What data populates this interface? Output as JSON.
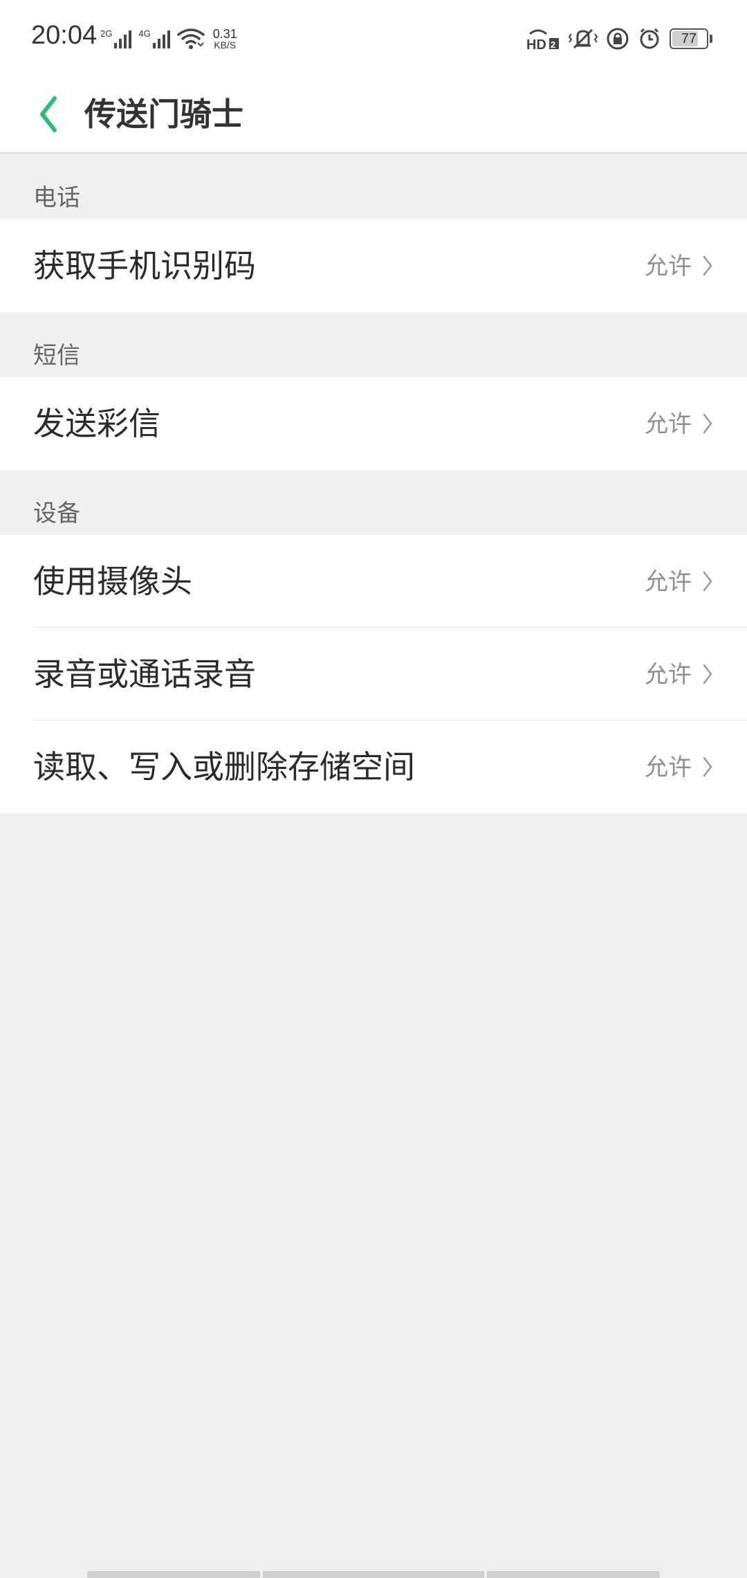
{
  "status_bar": {
    "time": "20:04",
    "sim1_label": "2G",
    "sim2_label": "4G",
    "speed_value": "0.31",
    "speed_unit": "KB/S",
    "battery": "77",
    "battery_level": 0.77
  },
  "header": {
    "title": "传送门骑士"
  },
  "sections": [
    {
      "title": "电话",
      "items": [
        {
          "label": "获取手机识别码",
          "value": "允许"
        }
      ]
    },
    {
      "title": "短信",
      "items": [
        {
          "label": "发送彩信",
          "value": "允许"
        }
      ]
    },
    {
      "title": "设备",
      "items": [
        {
          "label": "使用摄像头",
          "value": "允许"
        },
        {
          "label": "录音或通话录音",
          "value": "允许"
        },
        {
          "label": "读取、写入或删除存储空间",
          "value": "允许"
        }
      ]
    }
  ],
  "colors": {
    "accent": "#2dbb78",
    "background": "#f0f0f0",
    "card": "#ffffff"
  }
}
